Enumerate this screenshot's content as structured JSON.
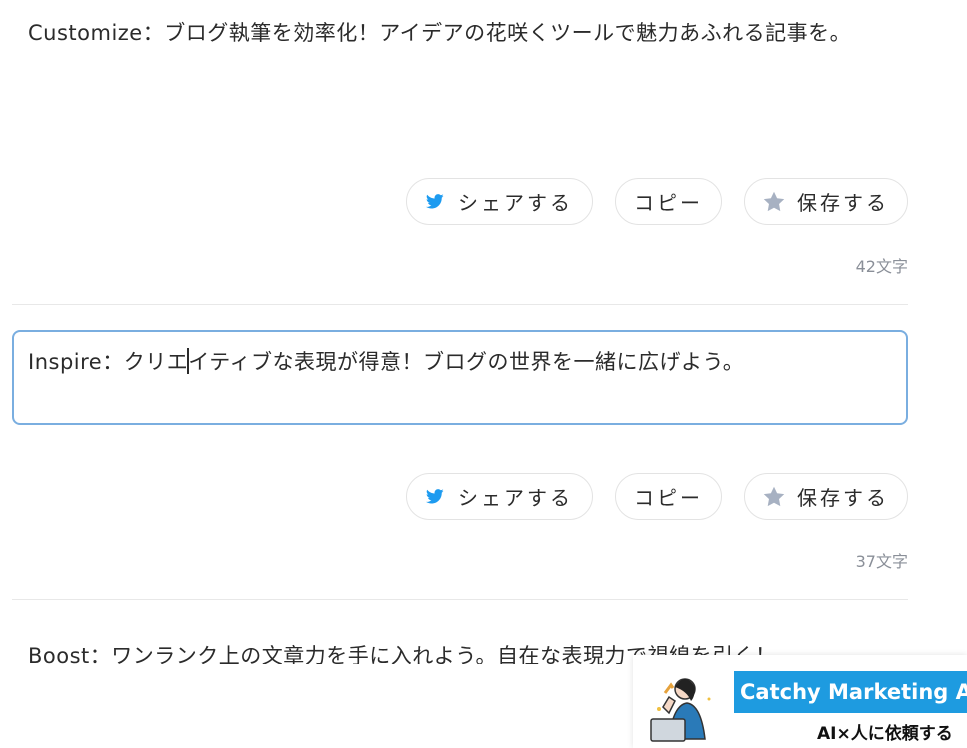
{
  "cards": [
    {
      "text": "Customize：ブログ執筆を効率化！アイデアの花咲くツールで魅力あふれる記事を。",
      "count": "42文字"
    },
    {
      "text_before_caret": "Inspire：クリエ",
      "text_after_caret": "イティブな表現が得意！ブログの世界を一緒に広げよう。",
      "count": "37文字"
    },
    {
      "text": "Boost：ワンランク上の文章力を手に入れよう。自在な表現力で視線を引く！"
    }
  ],
  "actions": {
    "share_label": "シェアする",
    "copy_label": "コピー",
    "save_label": "保存する"
  },
  "icons": {
    "share": "twitter-bird-icon",
    "save": "star-icon"
  },
  "colors": {
    "twitter": "#1d9bf0",
    "star": "#a7b1c2",
    "focus_border": "#7aaee0",
    "ad_banner": "#1e9be0"
  },
  "ad": {
    "title": "Catchy Marketing As",
    "subtitle": "AI×人に依頼する"
  }
}
